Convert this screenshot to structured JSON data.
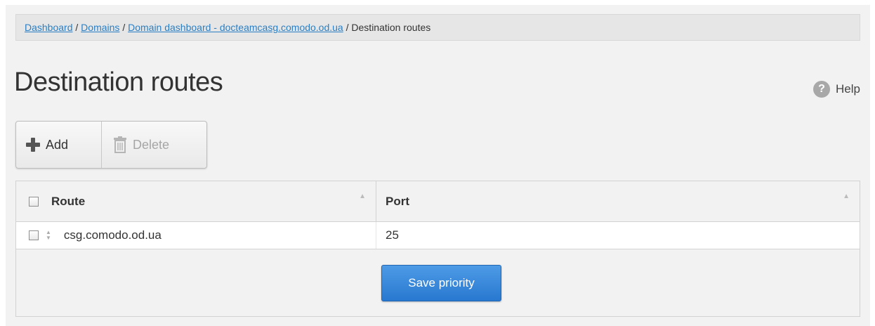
{
  "breadcrumb": {
    "links": [
      "Dashboard",
      "Domains",
      "Domain dashboard - docteamcasg.comodo.od.ua"
    ],
    "separator": "/",
    "current": "Destination routes"
  },
  "page_title": "Destination routes",
  "help": {
    "icon": "question-icon",
    "glyph": "?",
    "label": "Help"
  },
  "toolbar": {
    "add_label": "Add",
    "add_icon": "plus-icon",
    "delete_label": "Delete",
    "delete_icon": "trash-icon"
  },
  "table": {
    "columns": [
      "Route",
      "Port"
    ],
    "rows": [
      {
        "route": "csg.comodo.od.ua",
        "port": "25"
      }
    ]
  },
  "save_priority_label": "Save priority",
  "colors": {
    "link": "#2a7fc4",
    "primary_button": "#3385da",
    "background": "#f2f2f2"
  }
}
